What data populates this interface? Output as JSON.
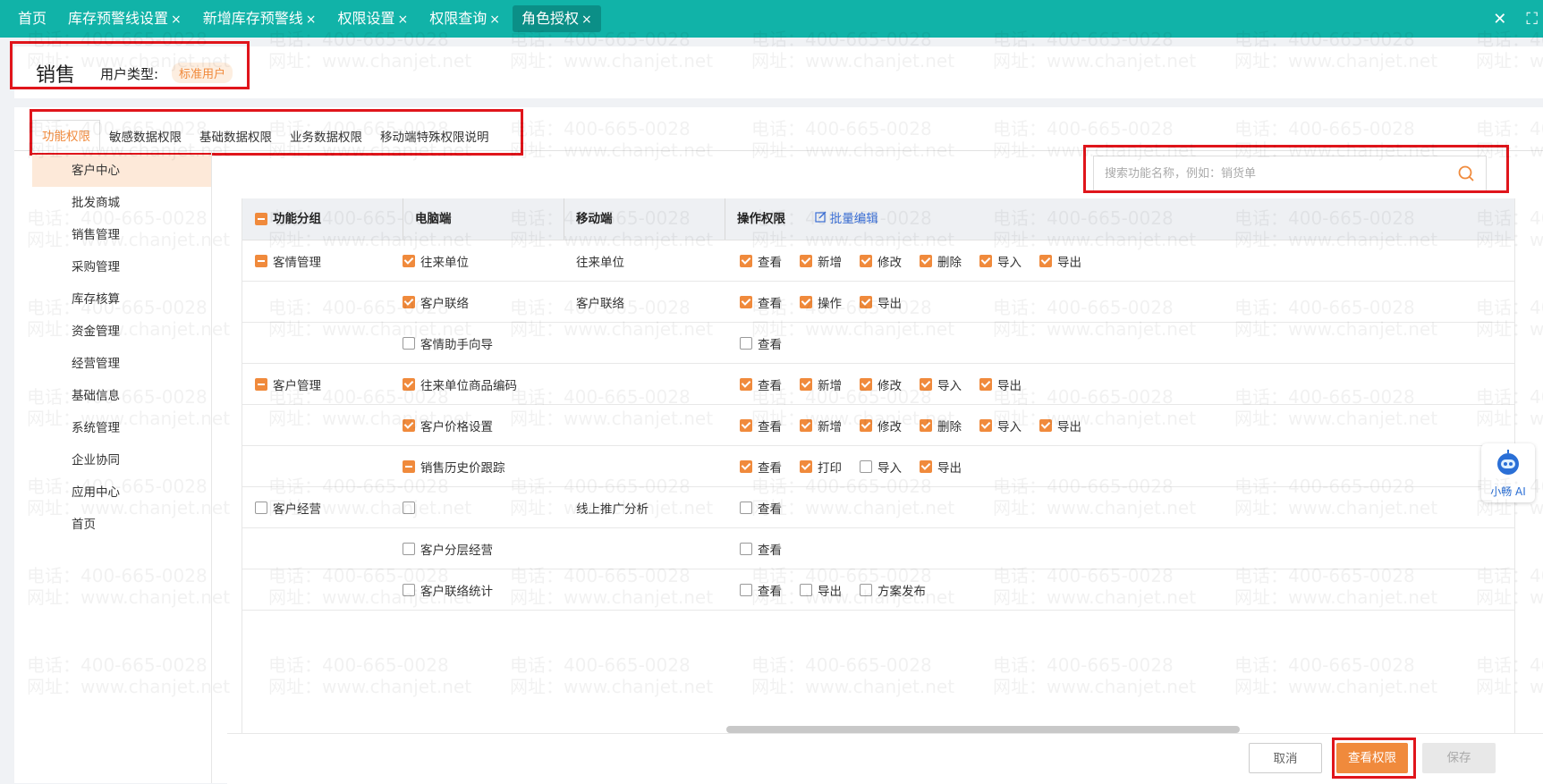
{
  "topbar": {
    "tabs": [
      {
        "label": "首页",
        "closable": false,
        "active": false
      },
      {
        "label": "库存预警线设置",
        "closable": true,
        "active": false
      },
      {
        "label": "新增库存预警线",
        "closable": true,
        "active": false
      },
      {
        "label": "权限设置",
        "closable": true,
        "active": false
      },
      {
        "label": "权限查询",
        "closable": true,
        "active": false
      },
      {
        "label": "角色授权",
        "closable": true,
        "active": true
      }
    ],
    "close_glyph": "×",
    "window_close": "✕",
    "window_max": "⛶"
  },
  "header": {
    "role_name": "销售",
    "user_type_label": "用户类型:",
    "user_type_value": "标准用户"
  },
  "subtabs": [
    "功能权限",
    "敏感数据权限",
    "基础数据权限",
    "业务数据权限",
    "移动端特殊权限说明"
  ],
  "sidebar": {
    "items": [
      "客户中心",
      "批发商城",
      "销售管理",
      "采购管理",
      "库存核算",
      "资金管理",
      "经营管理",
      "基础信息",
      "系统管理",
      "企业协同",
      "应用中心",
      "首页"
    ],
    "active_index": 0
  },
  "search": {
    "placeholder": "搜索功能名称，例如：销货单",
    "value": ""
  },
  "table": {
    "headers": {
      "group": "功能分组",
      "pc": "电脑端",
      "mobile": "移动端",
      "ops": "操作权限",
      "batch_edit": "批量编辑"
    },
    "rows": [
      {
        "group": "客情管理",
        "group_state": "partial",
        "pc": "往来单位",
        "pc_state": "checked",
        "mobile": "往来单位",
        "ops": [
          {
            "label": "查看",
            "checked": true
          },
          {
            "label": "新增",
            "checked": true
          },
          {
            "label": "修改",
            "checked": true
          },
          {
            "label": "删除",
            "checked": true
          },
          {
            "label": "导入",
            "checked": true
          },
          {
            "label": "导出",
            "checked": true
          }
        ]
      },
      {
        "group": "",
        "group_state": "none",
        "pc": "客户联络",
        "pc_state": "checked",
        "mobile": "客户联络",
        "ops": [
          {
            "label": "查看",
            "checked": true
          },
          {
            "label": "操作",
            "checked": true
          },
          {
            "label": "导出",
            "checked": true
          }
        ]
      },
      {
        "group": "",
        "group_state": "none",
        "pc": "客情助手向导",
        "pc_state": "unchecked",
        "mobile": "",
        "ops": [
          {
            "label": "查看",
            "checked": false
          }
        ]
      },
      {
        "group": "客户管理",
        "group_state": "partial",
        "pc": "往来单位商品编码",
        "pc_state": "checked",
        "mobile": "",
        "ops": [
          {
            "label": "查看",
            "checked": true
          },
          {
            "label": "新增",
            "checked": true
          },
          {
            "label": "修改",
            "checked": true
          },
          {
            "label": "导入",
            "checked": true
          },
          {
            "label": "导出",
            "checked": true
          }
        ]
      },
      {
        "group": "",
        "group_state": "none",
        "pc": "客户价格设置",
        "pc_state": "checked",
        "mobile": "",
        "ops": [
          {
            "label": "查看",
            "checked": true
          },
          {
            "label": "新增",
            "checked": true
          },
          {
            "label": "修改",
            "checked": true
          },
          {
            "label": "删除",
            "checked": true
          },
          {
            "label": "导入",
            "checked": true
          },
          {
            "label": "导出",
            "checked": true
          }
        ]
      },
      {
        "group": "",
        "group_state": "none",
        "pc": "销售历史价跟踪",
        "pc_state": "partial",
        "mobile": "",
        "ops": [
          {
            "label": "查看",
            "checked": true
          },
          {
            "label": "打印",
            "checked": true
          },
          {
            "label": "导入",
            "checked": false
          },
          {
            "label": "导出",
            "checked": true
          }
        ]
      },
      {
        "group": "客户经营",
        "group_state": "unchecked",
        "pc": "",
        "pc_state": "unchecked",
        "mobile": "线上推广分析",
        "ops": [
          {
            "label": "查看",
            "checked": false
          }
        ]
      },
      {
        "group": "",
        "group_state": "none",
        "pc": "客户分层经营",
        "pc_state": "unchecked",
        "mobile": "",
        "ops": [
          {
            "label": "查看",
            "checked": false
          }
        ]
      },
      {
        "group": "",
        "group_state": "none",
        "pc": "客户联络统计",
        "pc_state": "unchecked",
        "mobile": "",
        "ops": [
          {
            "label": "查看",
            "checked": false
          },
          {
            "label": "导出",
            "checked": false
          },
          {
            "label": "方案发布",
            "checked": false
          }
        ]
      }
    ]
  },
  "footer": {
    "cancel": "取消",
    "view_permissions": "查看权限",
    "save": "保存"
  },
  "ai_assistant": {
    "label": "小畅 AI"
  },
  "watermark": {
    "phone": "电话：400-665-0028",
    "site": "网址：www.chanjet.net"
  },
  "colors": {
    "topbar": "#11b3a8",
    "accent": "#f08a3c",
    "highlight_box": "#e0151b",
    "link": "#3b6fd6"
  }
}
